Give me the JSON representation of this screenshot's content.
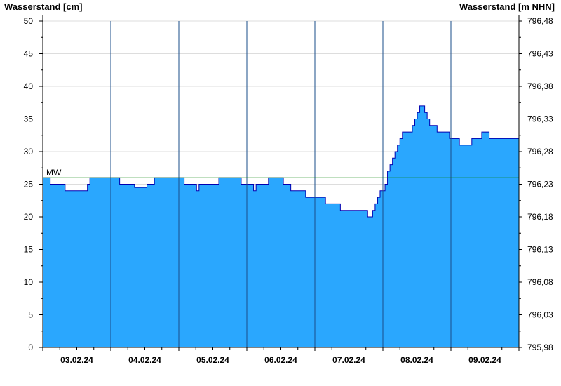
{
  "chart_data": {
    "type": "area",
    "title": "",
    "ylabel_left": "Wasserstand [cm]",
    "ylabel_right": "Wasserstand [m NHN]",
    "ylim": [
      0,
      50
    ],
    "yticks": [
      0,
      5,
      10,
      15,
      20,
      25,
      30,
      35,
      40,
      45,
      50
    ],
    "ylim_right": [
      795.98,
      796.48
    ],
    "yticks_right": [
      "795,98",
      "796,03",
      "796,08",
      "796,13",
      "796,18",
      "796,23",
      "796,28",
      "796,33",
      "796,38",
      "796,43",
      "796,48"
    ],
    "xlim_days": [
      "02.02.24",
      "09.02.24"
    ],
    "x_labels": [
      "03.02.24",
      "04.02.24",
      "05.02.24",
      "06.02.24",
      "07.02.24",
      "08.02.24",
      "09.02.24"
    ],
    "grid": true,
    "reference_lines": [
      {
        "label": "MW",
        "value": 26,
        "color": "#008000"
      }
    ],
    "series": [
      {
        "color": "#2aa7fe",
        "line_color": "#0000b0",
        "points": [
          [
            "02.02.24 00:00",
            26
          ],
          [
            "02.02.24 02:00",
            26
          ],
          [
            "02.02.24 03:00",
            25
          ],
          [
            "02.02.24 08:00",
            25
          ],
          [
            "02.02.24 09:00",
            24
          ],
          [
            "02.02.24 17:00",
            24
          ],
          [
            "02.02.24 18:00",
            25
          ],
          [
            "02.02.24 19:00",
            26
          ],
          [
            "03.02.24 06:00",
            26
          ],
          [
            "03.02.24 07:00",
            25
          ],
          [
            "03.02.24 12:00",
            25
          ],
          [
            "03.02.24 13:00",
            24.5
          ],
          [
            "03.02.24 18:00",
            25
          ],
          [
            "03.02.24 21:00",
            26
          ],
          [
            "04.02.24 08:00",
            26
          ],
          [
            "04.02.24 09:00",
            25
          ],
          [
            "04.02.24 13:00",
            25
          ],
          [
            "04.02.24 14:00",
            24
          ],
          [
            "04.02.24 15:00",
            25
          ],
          [
            "04.02.24 22:00",
            25
          ],
          [
            "04.02.24 23:00",
            26
          ],
          [
            "05.02.24 07:00",
            26
          ],
          [
            "05.02.24 08:00",
            25
          ],
          [
            "05.02.24 12:00",
            25
          ],
          [
            "05.02.24 13:00",
            24
          ],
          [
            "05.02.24 14:00",
            25
          ],
          [
            "05.02.24 19:00",
            26
          ],
          [
            "06.02.24 00:00",
            26
          ],
          [
            "06.02.24 01:00",
            25
          ],
          [
            "06.02.24 03:00",
            25
          ],
          [
            "06.02.24 04:00",
            24
          ],
          [
            "06.02.24 09:00",
            24
          ],
          [
            "06.02.24 10:00",
            23
          ],
          [
            "06.02.24 17:00",
            23
          ],
          [
            "06.02.24 18:00",
            22
          ],
          [
            "06.02.24 23:00",
            22
          ],
          [
            "07.02.24 00:00",
            21
          ],
          [
            "07.02.24 10:00",
            21
          ],
          [
            "07.02.24 11:00",
            20
          ],
          [
            "07.02.24 13:00",
            21
          ],
          [
            "07.02.24 14:00",
            22
          ],
          [
            "07.02.24 15:00",
            23
          ],
          [
            "07.02.24 16:00",
            24
          ],
          [
            "07.02.24 18:00",
            25
          ],
          [
            "07.02.24 19:00",
            27
          ],
          [
            "07.02.24 20:00",
            28
          ],
          [
            "07.02.24 21:00",
            29
          ],
          [
            "07.02.24 22:00",
            30
          ],
          [
            "07.02.24 23:00",
            31
          ],
          [
            "08.02.24 00:00",
            32
          ],
          [
            "08.02.24 01:00",
            33
          ],
          [
            "08.02.24 04:00",
            33
          ],
          [
            "08.02.24 05:00",
            34
          ],
          [
            "08.02.24 06:00",
            35
          ],
          [
            "08.02.24 07:00",
            36
          ],
          [
            "08.02.24 08:00",
            37
          ],
          [
            "08.02.24 09:30",
            37
          ],
          [
            "08.02.24 10:00",
            36
          ],
          [
            "08.02.24 11:00",
            35
          ],
          [
            "08.02.24 12:00",
            34
          ],
          [
            "08.02.24 14:00",
            34
          ],
          [
            "08.02.24 15:00",
            33
          ],
          [
            "08.02.24 19:00",
            33
          ],
          [
            "08.02.24 20:00",
            32
          ],
          [
            "08.02.24 23:00",
            32
          ],
          [
            "09.02.24 00:00",
            31
          ],
          [
            "09.02.24 04:00",
            31
          ],
          [
            "09.02.24 05:00",
            32
          ],
          [
            "09.02.24 08:00",
            32
          ],
          [
            "09.02.24 09:00",
            33
          ],
          [
            "09.02.24 11:00",
            33
          ],
          [
            "09.02.24 12:00",
            32
          ]
        ]
      }
    ]
  }
}
